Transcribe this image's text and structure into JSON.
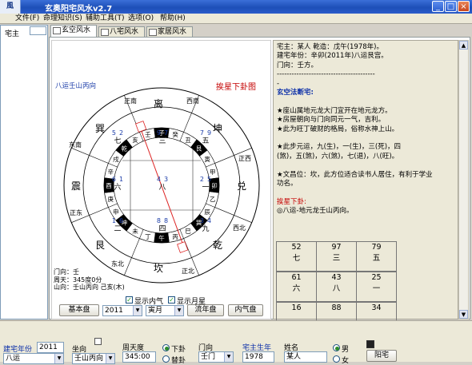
{
  "window": {
    "icon_text": "風",
    "title": "玄奥阳宅风水v2.7",
    "btn_min": "_",
    "btn_max": "□",
    "btn_close": "×"
  },
  "menu": [
    "文件(F)",
    "命理知识(S)",
    "辅助工具(T)",
    "选项(O)",
    "帮助(H)"
  ],
  "left": {
    "label": "宅主"
  },
  "tabs": [
    {
      "label": "玄空风水"
    },
    {
      "label": "八宅风水"
    },
    {
      "label": "家居风水"
    }
  ],
  "chart": {
    "heading_left": "八运壬山丙向",
    "heading_right": "挨星下卦图",
    "outer": {
      "n": "离",
      "s": "坎",
      "e": "震",
      "w": "兑",
      "ne": "艮",
      "nw": "乾",
      "se": "巽",
      "sw": "坤"
    },
    "ring2": {
      "zn": "正南",
      "zs": "正北",
      "ze": "正东",
      "zw": "正西",
      "xn": "西南",
      "xb": "西北",
      "dn": "东南",
      "db": "东北"
    },
    "palaces": {
      "c": {
        "a": "4",
        "b": "3",
        "y": "八"
      },
      "n": {
        "a": "9",
        "b": "7",
        "y": "三"
      },
      "s": {
        "a": "8",
        "b": "8",
        "y": "四"
      },
      "e": {
        "a": "6",
        "b": "1",
        "y": "六"
      },
      "w": {
        "a": "2",
        "b": "5",
        "y": "一"
      },
      "se": {
        "a": "5",
        "b": "2",
        "y": "七"
      },
      "sw": {
        "a": "7",
        "b": "9",
        "y": "五"
      },
      "ne": {
        "a": "1",
        "b": "6",
        "y": "二"
      },
      "nw": {
        "a": "3",
        "b": "4",
        "y": "九"
      }
    },
    "stems": [
      "丙",
      "午",
      "丁",
      "未",
      "坤",
      "申",
      "庚",
      "酉",
      "辛",
      "戌",
      "乾",
      "亥",
      "壬",
      "子",
      "癸",
      "丑",
      "艮",
      "寅",
      "甲",
      "卯",
      "乙",
      "辰",
      "巽",
      "巳"
    ],
    "info": [
      "门向：壬",
      "周天：345度0分",
      "山向：壬山丙向 己亥(木)"
    ]
  },
  "controls": {
    "chk_inner": "显示内气",
    "chk_month": "显示月星",
    "btn_basic": "基本盘",
    "year": "2011",
    "month": "寅月",
    "btn_flow": "流年盘",
    "btn_inner": "内气盘"
  },
  "text": {
    "lines": [
      "宅主：某人     乾造：戊午(1978年)。",
      "建宅年份：辛卯(2011年)八运艮宫。",
      "门向：壬方。",
      "----------------------------------------",
      "-",
      "玄空法断宅:",
      "",
      "★座山属地元龙大门宜开在地元龙方。",
      "★房屋朝向与门向同元一气，吉利。",
      "★此为旺丁破财的格局，俗称水神上山。",
      "",
      "★此步元运，九(生)，一(生)，三(死)，四",
      "(煞)，五(煞)，六(煞)，七(退)，八(旺)。",
      "",
      "★文昌位：坎，此方位适合读书人居住，有利于学业",
      "功名。",
      "",
      "挨星下卦:",
      "◎八运-地元龙壬山丙向。"
    ],
    "grid": [
      [
        "52",
        "七"
      ],
      [
        "97",
        "三"
      ],
      [
        "79",
        "五"
      ],
      [
        "61",
        "六"
      ],
      [
        "43",
        "八"
      ],
      [
        "25",
        "一"
      ],
      [
        "16",
        ""
      ],
      [
        "88",
        ""
      ],
      [
        "34",
        ""
      ]
    ]
  },
  "bottom": {
    "year_label": "建宅年份",
    "year_value": "2011",
    "yun_value": "八运",
    "zuo_label": "坐向",
    "zuo_value": "壬山丙向",
    "deg_label": "周天度",
    "deg_value": "345:00",
    "radio_xia": "下卦",
    "radio_ti": "替卦",
    "door_label": "门向",
    "door_value": "壬门",
    "owner_year_label": "宅主生年",
    "owner_year_value": "1978",
    "name_label": "姓名",
    "name_value": "某人",
    "sex_male": "男",
    "sex_female": "女",
    "tool_label": "阳宅"
  }
}
